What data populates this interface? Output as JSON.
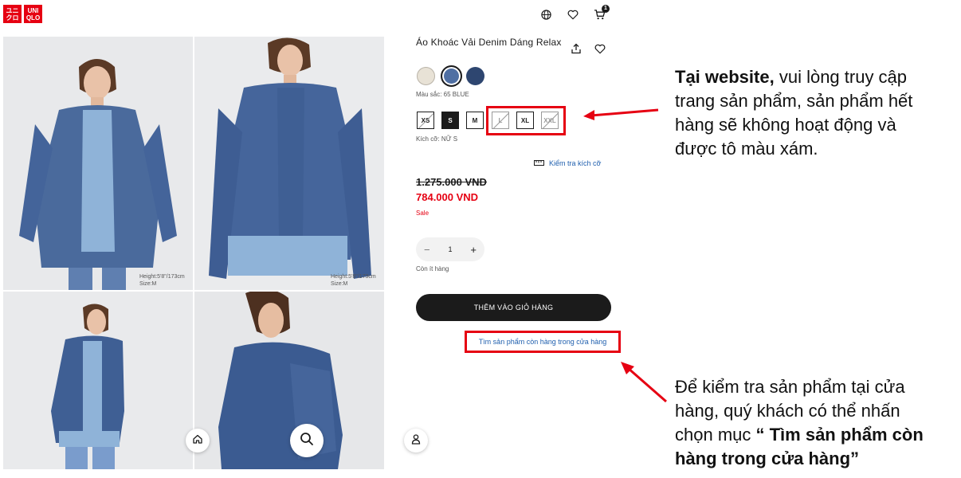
{
  "header": {
    "logo_text_1": "ユニクロ",
    "logo_text_2": "UNI QLO",
    "cart_count": "1",
    "icons": [
      "globe-icon",
      "heart-icon",
      "cart-icon"
    ]
  },
  "gallery": {
    "captions": [
      {
        "height": "Height:5'8\"/173cm",
        "size": "Size:M"
      },
      {
        "height": "Height:5'8\"/173cm",
        "size": "Size:M"
      }
    ]
  },
  "product": {
    "title": "Áo Khoác Vải Denim Dáng Relax",
    "color_label": "Màu sắc: 65 BLUE",
    "colors": [
      "#e8e2d6",
      "#4f6fa3",
      "#2e4670"
    ],
    "sizes": [
      "XS",
      "S",
      "M",
      "L",
      "XL",
      "XXL"
    ],
    "size_label": "Kích cỡ: NỮ S",
    "size_check": "Kiểm tra kích cỡ",
    "price_old": "1.275.000 VND",
    "price_new": "784.000 VND",
    "sale": "Sale",
    "qty_minus": "−",
    "qty_value": "1",
    "qty_plus": "+",
    "stock": "Còn ít hàng",
    "add_to_cart": "THÊM VÀO GIỎ HÀNG",
    "find_in_store": "Tìm sản phẩm còn hàng trong cửa hàng"
  },
  "annotations": {
    "top_bold": "Tại website,",
    "top_rest_1": " vui lòng truy cập",
    "top_line_2": "trang sản phẩm, sản phẩm hết",
    "top_line_3": "hàng sẽ không hoạt động và",
    "top_line_4": "được tô màu xám.",
    "bottom_line_1": "Để kiểm tra sản phẩm tại cửa",
    "bottom_line_2": "hàng, quý khách có thể nhấn",
    "bottom_line_3a": "chọn mục ",
    "bottom_line_3b": "“ Tìm sản phẩm còn",
    "bottom_line_4": "hàng trong cửa hàng”"
  },
  "colors": {
    "brand_red": "#e60012",
    "dark": "#1b1b1b",
    "link_blue": "#1f5fae"
  }
}
